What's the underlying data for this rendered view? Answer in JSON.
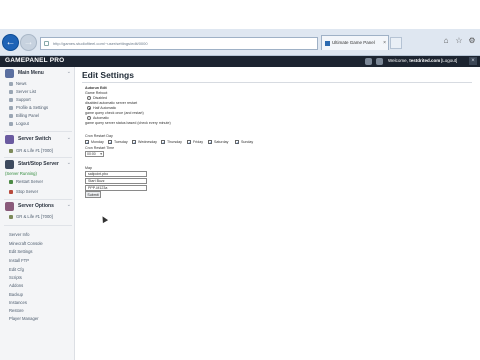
{
  "browser": {
    "address": "http://games.studiofiteel.com/~user/settings/edit/0000",
    "tab_title": "Ultimate Game Panel"
  },
  "header": {
    "logo": "GAMEPANEL PRO",
    "welcome_prefix": "Welcome,",
    "welcome_user": "testdrited.com",
    "logout": "[Logout]"
  },
  "sidebar": {
    "main_menu": {
      "title": "Main Menu",
      "items": [
        "News",
        "Server List",
        "Support",
        "Profile & Settings",
        "Billing Panel",
        "Logout"
      ]
    },
    "server_switch": {
      "title": "Server Switch",
      "item": "GR & Life #1 [7000]"
    },
    "start_stop": {
      "title": "Start/Stop Server",
      "status": "(Server Running)",
      "restart": "Restart Server",
      "stop": "Stop Server"
    },
    "server_options": {
      "title": "Server Options",
      "item": "GR & Life #1 [7000]"
    },
    "links": [
      "Server Info",
      "Minecraft Console",
      "Edit Settings",
      "Install FTP",
      "Edit Cfg",
      "Scripts",
      "Addons",
      "Backup",
      "Instances",
      "Restore",
      "Player Manager"
    ]
  },
  "page": {
    "title": "Edit Settings",
    "section_title": "Autorun Edit",
    "game_reboot_label": "Game Reboot",
    "opt_disabled": "Disabled",
    "opt_disabled_desc": "disabled automatic server restart",
    "opt_half_auto": "Half Automatic",
    "opt_half_auto_desc": "game query check once (and restart)",
    "opt_auto": "Automatic",
    "opt_auto_desc": "game query server status based (check every minute)",
    "cron_label": "Cron Restart Day",
    "days": [
      "Monday",
      "Tuesday",
      "Wednesday",
      "Thursday",
      "Friday",
      "Saturday",
      "Sunday"
    ],
    "cron_time_label": "Cron Restart Time",
    "cron_time_value": "00:00",
    "map_label": "Map",
    "map_value": "sailpoint.pbo",
    "password_value": "Start Buzz",
    "mission_value": "PPP-M123a",
    "save_button": "Submit"
  }
}
